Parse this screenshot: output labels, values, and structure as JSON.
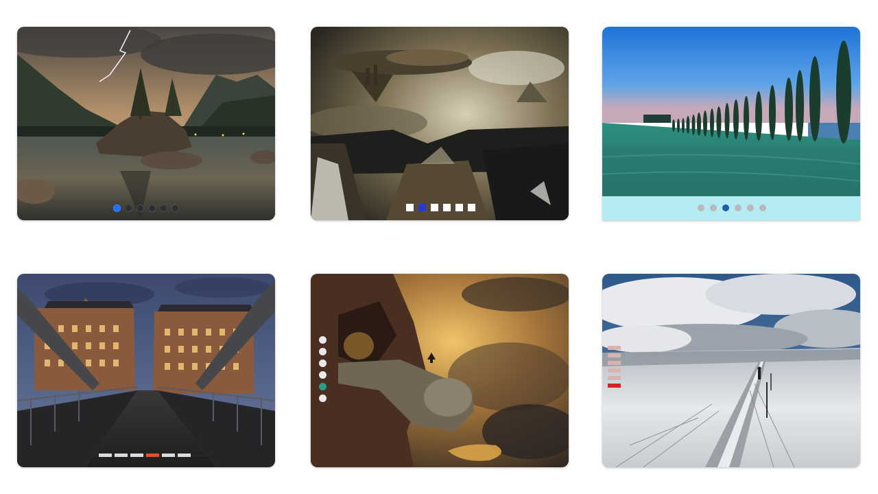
{
  "gallery": [
    {
      "id": "lake",
      "dot_count": 6,
      "active_index": 0,
      "indicator_style": "round-dots",
      "accent": "#1e6fff"
    },
    {
      "id": "fantasy",
      "dot_count": 6,
      "active_index": 1,
      "indicator_style": "square-dots",
      "accent": "#2a39c8"
    },
    {
      "id": "cypress",
      "dot_count": 6,
      "active_index": 2,
      "indicator_style": "round-dots-on-strip",
      "accent": "#1d5ea8"
    },
    {
      "id": "bridge",
      "dot_count": 6,
      "active_index": 3,
      "indicator_style": "dashes",
      "accent": "#e8502c"
    },
    {
      "id": "lion",
      "dot_count": 6,
      "active_index": 4,
      "indicator_style": "vertical-round-dots",
      "accent": "#2e9a8c"
    },
    {
      "id": "snow",
      "dot_count": 6,
      "active_index": 5,
      "indicator_style": "vertical-bars",
      "accent": "#d32323"
    }
  ]
}
